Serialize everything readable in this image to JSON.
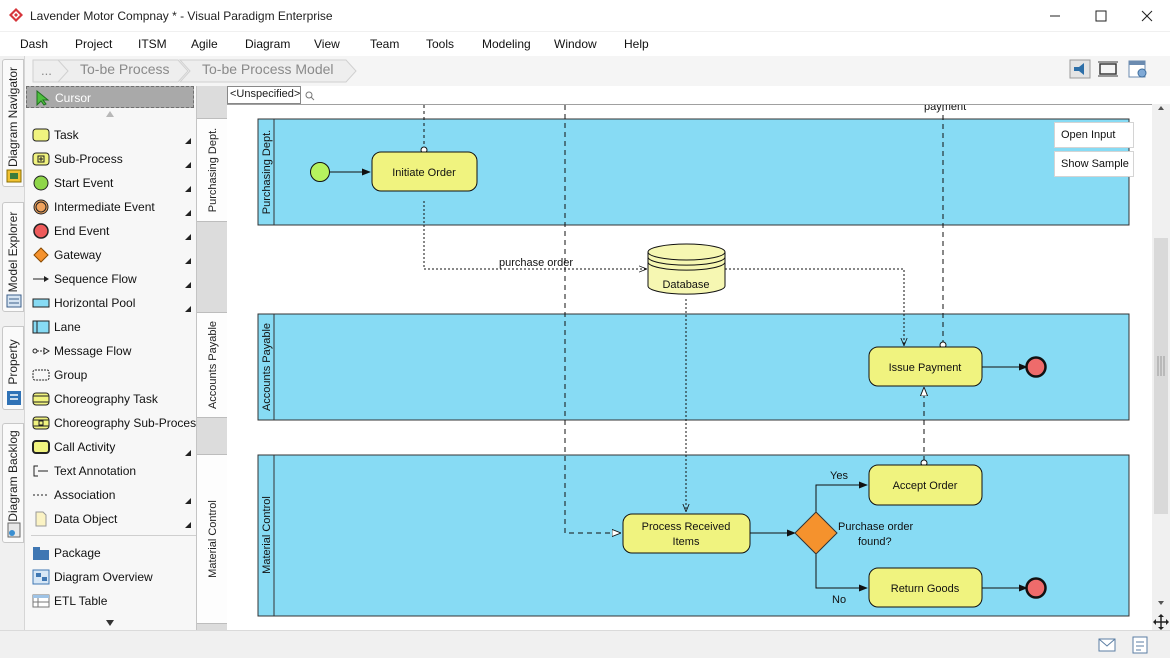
{
  "window": {
    "title": "Lavender Motor Compnay * - Visual Paradigm Enterprise"
  },
  "menu": [
    "Dash",
    "Project",
    "ITSM",
    "Agile",
    "Diagram",
    "View",
    "Team",
    "Tools",
    "Modeling",
    "Window",
    "Help"
  ],
  "breadcrumb": {
    "items": [
      "...",
      "To-be Process",
      "To-be Process Model"
    ]
  },
  "left_tabs": [
    "Diagram Navigator",
    "Model Explorer",
    "Property",
    "Diagram Backlog"
  ],
  "palette": {
    "cursor": "Cursor",
    "items": [
      {
        "label": "Task",
        "icon": "task-icon"
      },
      {
        "label": "Sub-Process",
        "icon": "sub-process-icon"
      },
      {
        "label": "Start Event",
        "icon": "start-event-icon"
      },
      {
        "label": "Intermediate Event",
        "icon": "intermediate-event-icon"
      },
      {
        "label": "End Event",
        "icon": "end-event-icon"
      },
      {
        "label": "Gateway",
        "icon": "gateway-icon"
      },
      {
        "label": "Sequence Flow",
        "icon": "sequence-flow-icon"
      },
      {
        "label": "Horizontal Pool",
        "icon": "horizontal-pool-icon"
      },
      {
        "label": "Lane",
        "icon": "lane-icon"
      },
      {
        "label": "Message Flow",
        "icon": "message-flow-icon"
      },
      {
        "label": "Group",
        "icon": "group-icon"
      },
      {
        "label": "Choreography Task",
        "icon": "choreography-task-icon"
      },
      {
        "label": "Choreography Sub-Process",
        "icon": "choreography-sub-process-icon"
      },
      {
        "label": "Call Activity",
        "icon": "call-activity-icon"
      },
      {
        "label": "Text Annotation",
        "icon": "text-annotation-icon"
      },
      {
        "label": "Association",
        "icon": "association-icon"
      },
      {
        "label": "Data Object",
        "icon": "data-object-icon"
      },
      {
        "label": "Package",
        "icon": "package-icon"
      },
      {
        "label": "Diagram Overview",
        "icon": "diagram-overview-icon"
      },
      {
        "label": "ETL Table",
        "icon": "etl-table-icon"
      }
    ]
  },
  "lane_strip": [
    "Purchasing Dept.",
    "Accounts Payable",
    "Material Control"
  ],
  "canvas_header": {
    "model_tab": "<Unspecified>"
  },
  "diagram": {
    "lanes": [
      "Purchasing Dept.",
      "Accounts Payable",
      "Material Control"
    ],
    "tasks": {
      "initiate_order": "Initiate Order",
      "issue_payment": "Issue Payment",
      "accept_order": "Accept Order",
      "process_received": [
        "Process Received",
        "Items"
      ],
      "return_goods": "Return Goods"
    },
    "data_store": "Database",
    "gateway_label": [
      "Purchase order",
      "found?"
    ],
    "flow_labels": {
      "purchase_order": "purchase order",
      "payment": "payment",
      "yes": "Yes",
      "no": "No"
    },
    "colors": {
      "lane_fill": "#87dbf4",
      "task_fill": "#f0f37f",
      "start_event": "#b6f35e",
      "end_event": "#ee6b6b",
      "gateway": "#f5922d"
    }
  },
  "side_buttons": [
    "Open Input",
    "Show Sample"
  ]
}
